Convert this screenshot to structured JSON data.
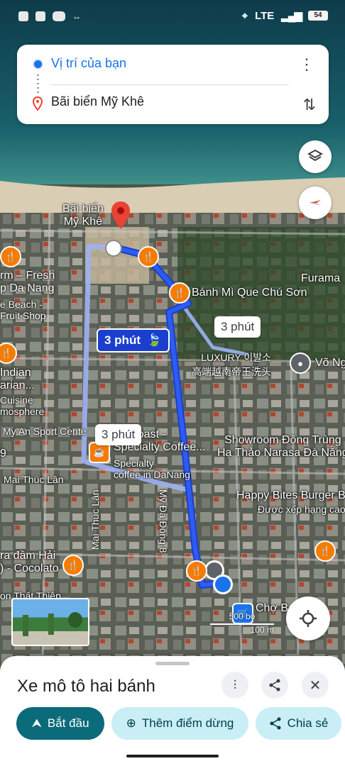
{
  "status_bar": {
    "network": "LTE",
    "battery": "54"
  },
  "route": {
    "origin": "Vị trí của bạn",
    "destination": "Bãi biển Mỹ Khê"
  },
  "durations": {
    "main": "3 phút",
    "alt1": "3 phút",
    "alt2": "3 phút"
  },
  "map_labels": {
    "beach": "Bãi biển\nMỹ Khê",
    "banh_mi": "Bánh Mì Que Chú Sơn",
    "furama": "Furama",
    "luxury": "LUXURY 이발소\n高端越南帝王洗头",
    "vo_ng": "Võ Ng",
    "farm_fresh": "rm – Fresh\np Da Nang",
    "beach_fruit": "e Beach -\nFruit Shop",
    "indian": "Indian\narian...",
    "cuisine": "Cuisine\nmosphere",
    "my_an": "My An Sport Cente",
    "first_roast": "rst Roast -\nSpecialty Coffee...",
    "specialty": "Specialty\ncoffee in DaNang",
    "showroom": "Showroom Đông Trùng\nHạ Thảo Narasa Đà Nẵng",
    "happy": "Happy Bites Burger Ba",
    "rated": "Được xếp hạng cao nh",
    "mai_thuc_lan_h": "Mai Thúc Lân",
    "mai_thuc_lan_v": "Mai Thúc Lân",
    "my_da_dong": "Mỹ Đa Đông 8",
    "ra_dam_hai": "ra đầm Hải\n) - Cocolato",
    "ton_that": "on Thất Thiệp",
    "cho_b": "Chợ B",
    "nine": "9"
  },
  "scale": {
    "imperial": "500 bộ",
    "metric": "100 m"
  },
  "sheet": {
    "title": "Xe mô tô hai bánh",
    "start": "Bắt đầu",
    "add_stop": "Thêm điểm dừng",
    "share": "Chia sẻ"
  },
  "colors": {
    "route_main": "#1a3fcf",
    "route_alt": "#9db3f5",
    "accent": "#0b6b7a"
  }
}
